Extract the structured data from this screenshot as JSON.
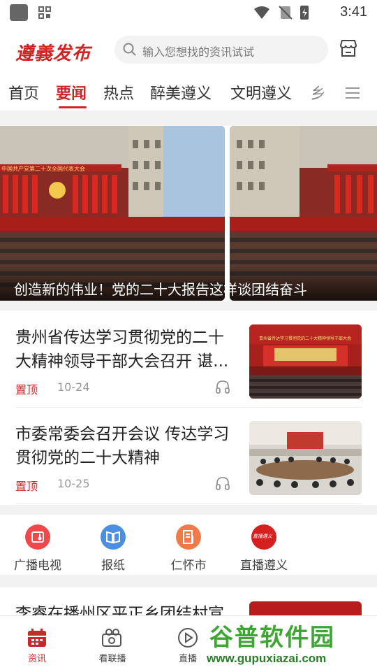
{
  "status_bar": {
    "time": "3:41"
  },
  "header": {
    "logo": "遵義发布",
    "search_placeholder": "输入您想找的资讯试试"
  },
  "tabs": [
    {
      "label": "首页",
      "active": false
    },
    {
      "label": "要闻",
      "active": true
    },
    {
      "label": "热点",
      "active": false
    },
    {
      "label": "醉美遵义",
      "active": false
    },
    {
      "label": "文明遵义",
      "active": false
    },
    {
      "label": "乡",
      "active": false
    }
  ],
  "carousel": {
    "caption": "创造新的伟业！党的二十大报告这样谈团结奋斗",
    "banner_text": "中国共产党第二十次全国代表大会"
  },
  "news": [
    {
      "title": "贵州省传达学习贯彻党的二十大精神领导干部大会召开 谌...",
      "tag": "置顶",
      "date": "10-24",
      "thumb_banner": "贵州省传达学习贯彻党的二十大精神领导干部大会"
    },
    {
      "title": "市委常委会召开会议 传达学习贯彻党的二十大精神",
      "tag": "置顶",
      "date": "10-25"
    }
  ],
  "quick_links": [
    {
      "label": "广播电视",
      "icon": "radio-icon",
      "color": "#f0484a"
    },
    {
      "label": "报纸",
      "icon": "book-icon",
      "color": "#4a8fe0"
    },
    {
      "label": "仁怀市",
      "icon": "document-icon",
      "color": "#f07a4a"
    },
    {
      "label": "直播遵义",
      "icon": "zunyi-logo-icon",
      "color": "#d61f1f",
      "icon_text": "直播遵义"
    }
  ],
  "peek": {
    "title": "李睿在播州区平正乡团结村宣"
  },
  "bottom_nav": [
    {
      "label": "资讯",
      "active": true
    },
    {
      "label": "看联播",
      "active": false
    },
    {
      "label": "直播",
      "active": false
    }
  ],
  "watermark": {
    "text": "谷普软件园",
    "url": "www.gupuxiazai.com"
  },
  "colors": {
    "accent": "#c9272b",
    "watermark_green": "#3fa535"
  }
}
